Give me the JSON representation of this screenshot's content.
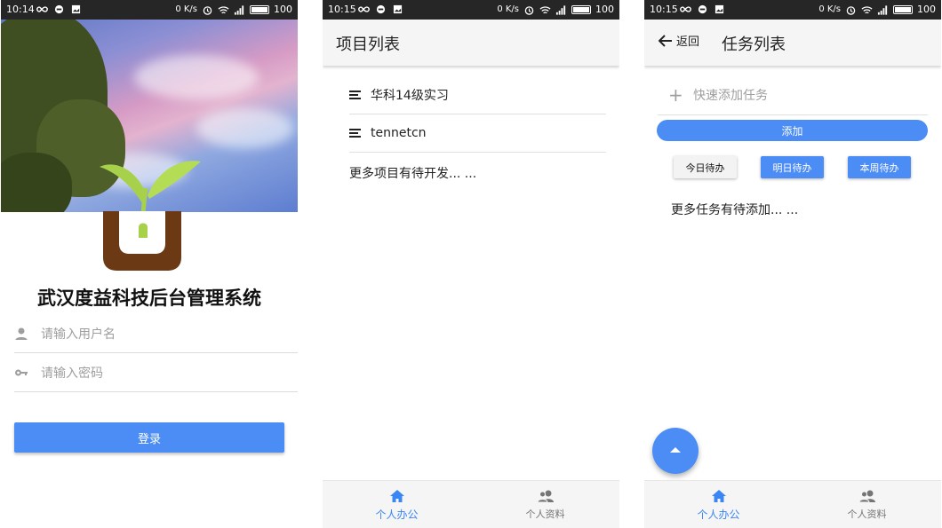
{
  "screens": [
    {
      "status": {
        "time": "10:14",
        "speed": "0 K/s",
        "battery": "100"
      },
      "app_title": "武汉度益科技后台管理系统",
      "username_placeholder": "请输入用户名",
      "password_placeholder": "请输入密码",
      "login_label": "登录"
    },
    {
      "status": {
        "time": "10:15",
        "speed": "0 K/s",
        "battery": "100"
      },
      "appbar_title": "项目列表",
      "projects": [
        "华科14级实习",
        "tennetcn"
      ],
      "more_text": "更多项目有待开发... ...",
      "nav": {
        "office": "个人办公",
        "profile": "个人资料"
      }
    },
    {
      "status": {
        "time": "10:15",
        "speed": "0 K/s",
        "battery": "100"
      },
      "back_label": "返回",
      "appbar_title": "任务列表",
      "quick_add_placeholder": "快速添加任务",
      "add_label": "添加",
      "filters": [
        "今日待办",
        "明日待办",
        "本周待办"
      ],
      "more_text": "更多任务有待添加... ...",
      "nav": {
        "office": "个人办公",
        "profile": "个人资料"
      }
    }
  ],
  "colors": {
    "accent": "#4b8cf5",
    "nav_active": "#3a86f3",
    "statusbar": "#262626",
    "appbar": "#f5f5f5",
    "logo_leaf": "#a8d14b",
    "logo_pot": "#6b3a14"
  },
  "icons": [
    "user-icon",
    "key-icon",
    "list-icon",
    "home-icon",
    "people-icon",
    "back-arrow-icon",
    "plus-icon",
    "fab-up-arrow-icon",
    "sprout-logo"
  ]
}
